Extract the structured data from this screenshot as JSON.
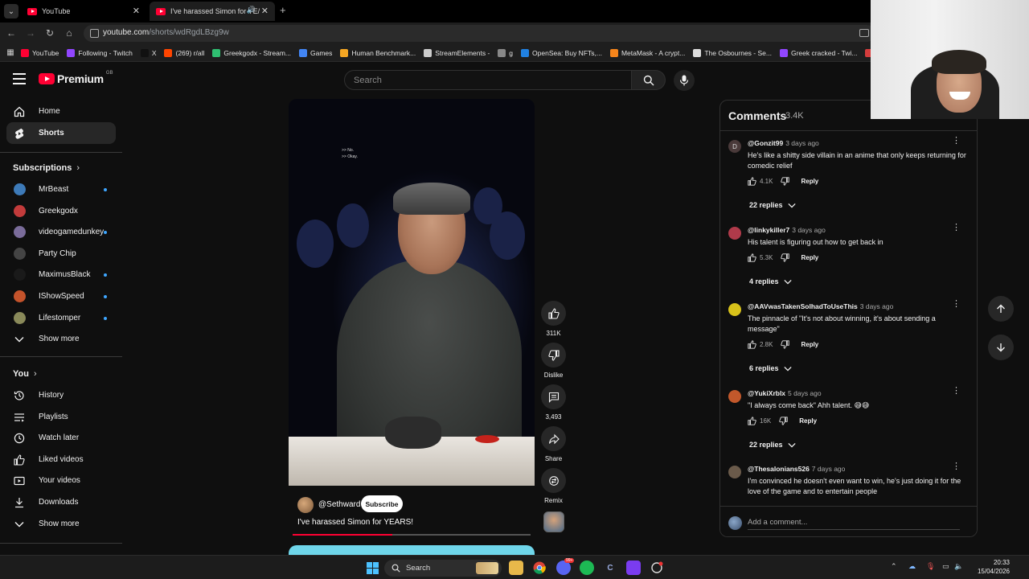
{
  "browser": {
    "tabs": [
      {
        "title": "YouTube",
        "active": false
      },
      {
        "title": "I've harassed Simon for YE/",
        "active": true
      }
    ],
    "url_host": "youtube.com",
    "url_path": "/shorts/wdRgdLBzg9w",
    "bookmarks": [
      {
        "label": "YouTube",
        "color": "#ff0033"
      },
      {
        "label": "Following - Twitch",
        "color": "#9146ff"
      },
      {
        "label": "X",
        "color": "#111111"
      },
      {
        "label": "(269) r/all",
        "color": "#ff4500"
      },
      {
        "label": "Greekgodx - Stream...",
        "color": "#2fbf71"
      },
      {
        "label": "Games",
        "color": "#4285f4"
      },
      {
        "label": "Human Benchmark...",
        "color": "#f5a623"
      },
      {
        "label": "StreamElements -",
        "color": "#cccccc"
      },
      {
        "label": "g",
        "color": "#888888"
      },
      {
        "label": "OpenSea: Buy NFTs,...",
        "color": "#2081e2"
      },
      {
        "label": "MetaMask - A crypt...",
        "color": "#f6851b"
      },
      {
        "label": "The Osbournes - Se...",
        "color": "#dddddd"
      },
      {
        "label": "Greek cracked - Twi...",
        "color": "#9146ff"
      },
      {
        "label": "D",
        "color": "#d43c3c"
      }
    ]
  },
  "masthead": {
    "logo_text": "Premium",
    "region": "GB",
    "search_placeholder": "Search"
  },
  "sidebar": {
    "main": [
      {
        "label": "Home",
        "icon": "home-icon",
        "active": false
      },
      {
        "label": "Shorts",
        "icon": "shorts-icon",
        "active": true
      }
    ],
    "subscriptions_title": "Subscriptions",
    "subscriptions": [
      {
        "label": "MrBeast",
        "dot": true,
        "color": "#3d7ab8"
      },
      {
        "label": "Greekgodx",
        "dot": false,
        "color": "#c23b3b"
      },
      {
        "label": "videogamedunkey",
        "dot": true,
        "color": "#7a6c9a"
      },
      {
        "label": "Party Chip",
        "dot": false,
        "color": "#444444"
      },
      {
        "label": "MaximusBlack",
        "dot": true,
        "color": "#1a1a1a"
      },
      {
        "label": "IShowSpeed",
        "dot": true,
        "color": "#c4532b"
      },
      {
        "label": "Lifestomper",
        "dot": true,
        "color": "#8a8a5a"
      }
    ],
    "subs_show_more": "Show more",
    "you_title": "You",
    "you_items": [
      {
        "label": "History",
        "icon": "history-icon"
      },
      {
        "label": "Playlists",
        "icon": "playlists-icon"
      },
      {
        "label": "Watch later",
        "icon": "watch-later-icon"
      },
      {
        "label": "Liked videos",
        "icon": "like-icon"
      },
      {
        "label": "Your videos",
        "icon": "your-videos-icon"
      },
      {
        "label": "Downloads",
        "icon": "download-icon"
      }
    ],
    "you_show_more": "Show more"
  },
  "short": {
    "ticker": [
      ">> No.",
      ">> Okay."
    ],
    "channel": "@Sethward",
    "subscribe_label": "Subscribe",
    "title": "I've harassed Simon for YEARS!",
    "progress": 0.42
  },
  "actions": {
    "like_count": "311K",
    "dislike_label": "Dislike",
    "comment_count": "3,493",
    "share_label": "Share",
    "remix_label": "Remix"
  },
  "comments": {
    "title": "Comments",
    "count": "3.4K",
    "reply_label": "Reply",
    "items": [
      {
        "user": "@Gonzit99",
        "time": "3 days ago",
        "text": "He's like a shitty side villain in an anime that only keeps returning for comedic relief",
        "likes": "4.1K",
        "replies": "22 replies",
        "avatar_letter": "D",
        "avatar_color": "#4a3a3a"
      },
      {
        "user": "@linkykiller7",
        "time": "3 days ago",
        "text": "His talent is figuring out how to get back in",
        "likes": "5.3K",
        "replies": "4 replies",
        "avatar_letter": "",
        "avatar_color": "#b03a4a"
      },
      {
        "user": "@AAVwasTakenSolhadToUseThis",
        "time": "3 days ago",
        "text": "The pinnacle of \"It's not about winning, it's about sending a message\"",
        "likes": "2.8K",
        "replies": "6 replies",
        "avatar_letter": "",
        "avatar_color": "#d8c21a"
      },
      {
        "user": "@YukiXrblx",
        "time": "5 days ago",
        "text": "\"I always come back\" Ahh talent. 😅😅",
        "likes": "16K",
        "replies": "22 replies",
        "avatar_letter": "",
        "avatar_color": "#c2582b"
      },
      {
        "user": "@Thesalonians526",
        "time": "7 days ago",
        "text": "I'm convinced he doesn't even want to win, he's just doing it for the love of the game and to entertain people",
        "likes": "",
        "replies": "",
        "avatar_letter": "",
        "avatar_color": "#6a5a4a"
      }
    ],
    "add_placeholder": "Add a comment..."
  },
  "taskbar": {
    "search_label": "Search",
    "time": "20:33",
    "date": "15/04/2026",
    "badge": "99+"
  }
}
